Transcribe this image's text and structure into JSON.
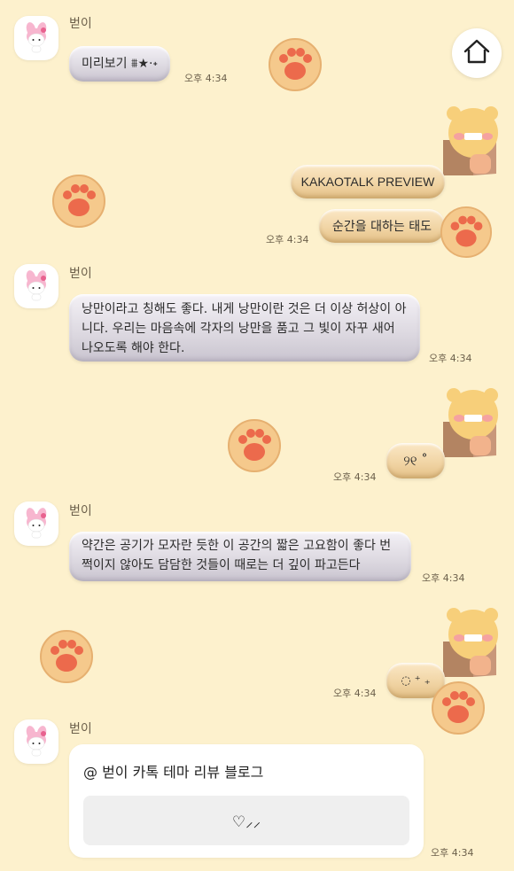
{
  "nav": {
    "home_icon": "home-icon"
  },
  "colors": {
    "background": "#fdf1cd",
    "bubble_in": "#dcd8e0",
    "bubble_out": "#f0d3a2",
    "paw": "#f4c88a",
    "paw_pad": "#ee6a4e"
  },
  "messages": [
    {
      "type": "received",
      "sender": "벋이",
      "text": "미리보기 ⩩★·˖",
      "time": "오후 4:34"
    },
    {
      "type": "sent",
      "text": "KAKAOTALK PREVIEW"
    },
    {
      "type": "sent",
      "text": "순간을 대하는 태도",
      "time": "오후 4:34"
    },
    {
      "type": "received",
      "sender": "벋이",
      "text": "낭만이라고 칭해도 좋다. 내게 낭만이란 것은 더 이상 허상이 아니다. 우리는 마음속에 각자의 낭만을 품고 그 빛이 자꾸 새어 나오도록 해야 한다.",
      "time": "오후 4:34"
    },
    {
      "type": "sent",
      "text": "୨୧ ˚",
      "time": "오후 4:34"
    },
    {
      "type": "received",
      "sender": "벋이",
      "text": "약간은 공기가 모자란 듯한 이 공간의 짧은 고요함이 좋다 번쩍이지 않아도 담담한 것들이 때로는 더 깊이 파고든다",
      "time": "오후 4:34"
    },
    {
      "type": "sent",
      "text": "◌ ⁺ ₊",
      "time": "오후 4:34"
    },
    {
      "type": "link",
      "sender": "벋이",
      "title": "@ 벋이 카톡 테마 리뷰 블로그",
      "action": "♡⸝⸝",
      "time": "오후 4:34"
    }
  ]
}
